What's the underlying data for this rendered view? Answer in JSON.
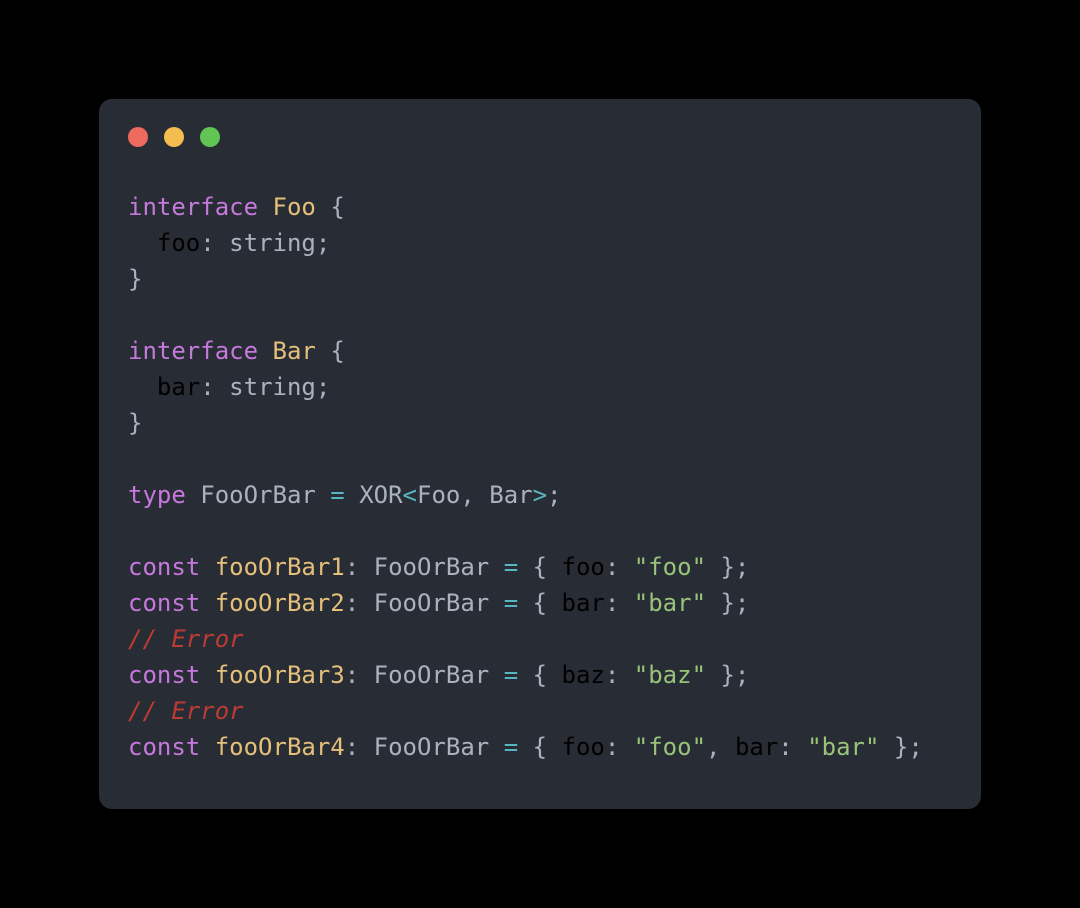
{
  "window": {
    "background_color": "#000000",
    "card_color": "#282c34",
    "traffic_lights": [
      {
        "name": "close",
        "color": "#ed6a5f"
      },
      {
        "name": "minimize",
        "color": "#f4bd4f"
      },
      {
        "name": "maximize",
        "color": "#61c554"
      }
    ]
  },
  "theme": {
    "keyword": "#c678dd",
    "type": "#e5c07b",
    "variable": "#e5c07b",
    "plain": "#abb2bf",
    "property": "#56b6c2",
    "operator": "#56b6c2",
    "string": "#98c379",
    "comment": "#be3b34"
  },
  "code": {
    "language": "typescript",
    "lines": [
      {
        "index": 1,
        "text": "interface Foo {",
        "tokens": [
          {
            "t": "interface",
            "c": "keyword"
          },
          {
            "t": " ",
            "c": "plain"
          },
          {
            "t": "Foo",
            "c": "type"
          },
          {
            "t": " ",
            "c": "plain"
          },
          {
            "t": "{",
            "c": "punct"
          }
        ]
      },
      {
        "index": 2,
        "text": "  foo: string;",
        "tokens": [
          {
            "t": "  ",
            "c": "plain"
          },
          {
            "t": "foo",
            "c": "property"
          },
          {
            "t": ": ",
            "c": "plain"
          },
          {
            "t": "string",
            "c": "plain"
          },
          {
            "t": ";",
            "c": "plain"
          }
        ]
      },
      {
        "index": 3,
        "text": "}",
        "tokens": [
          {
            "t": "}",
            "c": "punct"
          }
        ]
      },
      {
        "index": 4,
        "text": "",
        "tokens": []
      },
      {
        "index": 5,
        "text": "interface Bar {",
        "tokens": [
          {
            "t": "interface",
            "c": "keyword"
          },
          {
            "t": " ",
            "c": "plain"
          },
          {
            "t": "Bar",
            "c": "type"
          },
          {
            "t": " ",
            "c": "plain"
          },
          {
            "t": "{",
            "c": "punct"
          }
        ]
      },
      {
        "index": 6,
        "text": "  bar: string;",
        "tokens": [
          {
            "t": "  ",
            "c": "plain"
          },
          {
            "t": "bar",
            "c": "property"
          },
          {
            "t": ": ",
            "c": "plain"
          },
          {
            "t": "string",
            "c": "plain"
          },
          {
            "t": ";",
            "c": "plain"
          }
        ]
      },
      {
        "index": 7,
        "text": "}",
        "tokens": [
          {
            "t": "}",
            "c": "punct"
          }
        ]
      },
      {
        "index": 8,
        "text": "",
        "tokens": []
      },
      {
        "index": 9,
        "text": "type FooOrBar = XOR<Foo, Bar>;",
        "tokens": [
          {
            "t": "type",
            "c": "keyword"
          },
          {
            "t": " FooOrBar ",
            "c": "plain"
          },
          {
            "t": "=",
            "c": "operator"
          },
          {
            "t": " XOR",
            "c": "plain"
          },
          {
            "t": "<",
            "c": "operator"
          },
          {
            "t": "Foo, Bar",
            "c": "plain"
          },
          {
            "t": ">",
            "c": "operator"
          },
          {
            "t": ";",
            "c": "plain"
          }
        ]
      },
      {
        "index": 10,
        "text": "",
        "tokens": []
      },
      {
        "index": 11,
        "text": "const fooOrBar1: FooOrBar = { foo: \"foo\" };",
        "tokens": [
          {
            "t": "const",
            "c": "keyword"
          },
          {
            "t": " ",
            "c": "plain"
          },
          {
            "t": "fooOrBar1",
            "c": "var"
          },
          {
            "t": ": FooOrBar ",
            "c": "plain"
          },
          {
            "t": "=",
            "c": "operator"
          },
          {
            "t": " { ",
            "c": "plain"
          },
          {
            "t": "foo",
            "c": "property"
          },
          {
            "t": ": ",
            "c": "plain"
          },
          {
            "t": "\"foo\"",
            "c": "string"
          },
          {
            "t": " };",
            "c": "plain"
          }
        ]
      },
      {
        "index": 12,
        "text": "const fooOrBar2: FooOrBar = { bar: \"bar\" };",
        "tokens": [
          {
            "t": "const",
            "c": "keyword"
          },
          {
            "t": " ",
            "c": "plain"
          },
          {
            "t": "fooOrBar2",
            "c": "var"
          },
          {
            "t": ": FooOrBar ",
            "c": "plain"
          },
          {
            "t": "=",
            "c": "operator"
          },
          {
            "t": " { ",
            "c": "plain"
          },
          {
            "t": "bar",
            "c": "property"
          },
          {
            "t": ": ",
            "c": "plain"
          },
          {
            "t": "\"bar\"",
            "c": "string"
          },
          {
            "t": " };",
            "c": "plain"
          }
        ]
      },
      {
        "index": 13,
        "text": "// Error",
        "tokens": [
          {
            "t": "// Error",
            "c": "comment"
          }
        ]
      },
      {
        "index": 14,
        "text": "const fooOrBar3: FooOrBar = { baz: \"baz\" };",
        "tokens": [
          {
            "t": "const",
            "c": "keyword"
          },
          {
            "t": " ",
            "c": "plain"
          },
          {
            "t": "fooOrBar3",
            "c": "var"
          },
          {
            "t": ": FooOrBar ",
            "c": "plain"
          },
          {
            "t": "=",
            "c": "operator"
          },
          {
            "t": " { ",
            "c": "plain"
          },
          {
            "t": "baz",
            "c": "property"
          },
          {
            "t": ": ",
            "c": "plain"
          },
          {
            "t": "\"baz\"",
            "c": "string"
          },
          {
            "t": " };",
            "c": "plain"
          }
        ]
      },
      {
        "index": 15,
        "text": "// Error",
        "tokens": [
          {
            "t": "// Error",
            "c": "comment"
          }
        ]
      },
      {
        "index": 16,
        "text": "const fooOrBar4: FooOrBar = { foo: \"foo\", bar: \"bar\" };",
        "tokens": [
          {
            "t": "const",
            "c": "keyword"
          },
          {
            "t": " ",
            "c": "plain"
          },
          {
            "t": "fooOrBar4",
            "c": "var"
          },
          {
            "t": ": FooOrBar ",
            "c": "plain"
          },
          {
            "t": "=",
            "c": "operator"
          },
          {
            "t": " { ",
            "c": "plain"
          },
          {
            "t": "foo",
            "c": "property"
          },
          {
            "t": ": ",
            "c": "plain"
          },
          {
            "t": "\"foo\"",
            "c": "string"
          },
          {
            "t": ", ",
            "c": "plain"
          },
          {
            "t": "bar",
            "c": "property"
          },
          {
            "t": ": ",
            "c": "plain"
          },
          {
            "t": "\"bar\"",
            "c": "string"
          },
          {
            "t": " };",
            "c": "plain"
          }
        ]
      }
    ]
  }
}
